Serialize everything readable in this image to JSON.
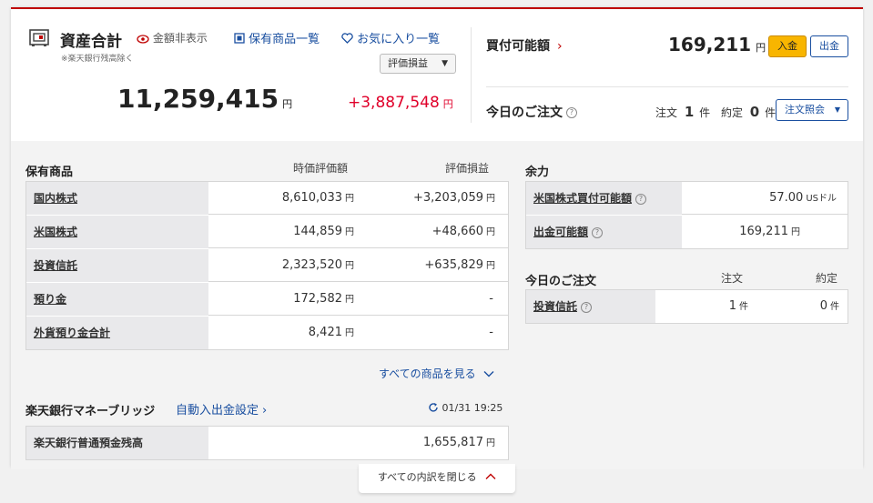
{
  "assets": {
    "title": "資産合計",
    "hide_amount_label": "金額非表示",
    "note": "※楽天銀行残高除く",
    "holdings_link": "保有商品一覧",
    "favorites_link": "お気に入り一覧",
    "pl_select": "評価損益",
    "total": "11,259,415",
    "unit": "円",
    "profit": "+3,887,548"
  },
  "buying_power": {
    "label": "買付可能額",
    "amount": "169,211",
    "unit": "円",
    "deposit_button": "入金",
    "withdraw_button": "出金"
  },
  "today_orders": {
    "label": "今日のご注文",
    "order_label": "注文",
    "order_count": "1",
    "contract_label": "約定",
    "contract_count": "0",
    "unit": "件",
    "inquiry_button": "注文照会"
  },
  "holdings": {
    "title": "保有商品",
    "col_value": "時価評価額",
    "col_pl": "評価損益",
    "unit": "円",
    "rows": [
      {
        "name": "国内株式",
        "value": "8,610,033",
        "pl": "+3,203,059"
      },
      {
        "name": "米国株式",
        "value": "144,859",
        "pl": "+48,660"
      },
      {
        "name": "投資信託",
        "value": "2,323,520",
        "pl": "+635,829"
      },
      {
        "name": "預り金",
        "value": "172,582",
        "pl": "-"
      },
      {
        "name": "外貨預り金合計",
        "value": "8,421",
        "pl": "-"
      }
    ],
    "see_all": "すべての商品を見る"
  },
  "bank": {
    "title": "楽天銀行マネーブリッジ",
    "auto_link": "自動入出金設定",
    "timestamp": "01/31 19:25",
    "row_label": "楽天銀行普通預金残高",
    "row_value": "1,655,817",
    "unit": "円"
  },
  "margin": {
    "title": "余力",
    "rows": [
      {
        "name": "米国株式買付可能額",
        "value": "57.00",
        "unit": "USドル"
      },
      {
        "name": "出金可能額",
        "value": "169,211",
        "unit": "円"
      }
    ]
  },
  "today_orders_detail": {
    "title": "今日のご注文",
    "col_order": "注文",
    "col_contract": "約定",
    "row_name": "投資信託",
    "row_order": "1",
    "row_contract": "0",
    "unit": "件"
  },
  "close_all": "すべての内訳を閉じる",
  "colors": {
    "accent_red": "#bf0000",
    "link_blue": "#1a4fa0",
    "profit_red": "#e0002a",
    "gold": "#f8b500"
  }
}
